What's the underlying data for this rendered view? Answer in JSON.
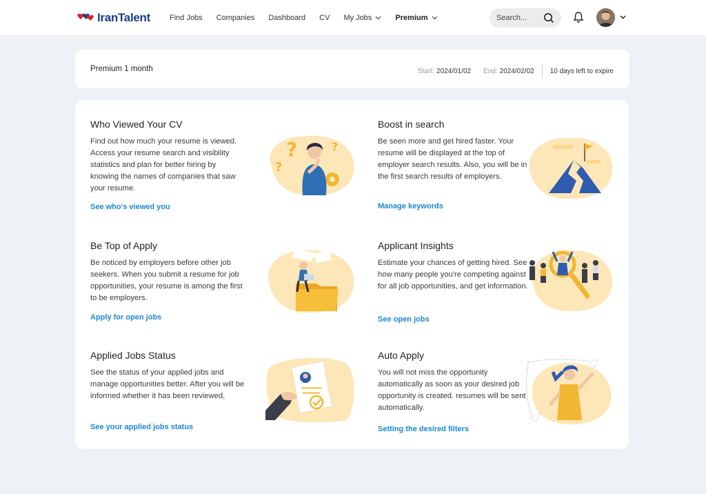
{
  "header": {
    "logo_text": "IranTalent",
    "nav": [
      {
        "label": "Find Jobs"
      },
      {
        "label": "Companies"
      },
      {
        "label": "Dashboard"
      },
      {
        "label": "CV"
      },
      {
        "label": "My Jobs"
      },
      {
        "label": "Premium"
      }
    ],
    "search_placeholder": "Search..."
  },
  "plan": {
    "title": "Premium 1 month",
    "start_label": "Start:",
    "start_value": "2024/01/02",
    "end_label": "End:",
    "end_value": "2024/02/02",
    "expire_text": "10 days left to expire"
  },
  "features": [
    {
      "title": "Who Viewed Your CV",
      "text": "Find out how much your resume is viewed. Access your resume search and visibility statistics and plan for better hiring by knowing the names of companies that saw your resume.",
      "link": "See who's viewed you"
    },
    {
      "title": "Boost in search",
      "text": "Be seen more and get hired faster. Your resume will be displayed at the top of employer search results. Also, you will be in the first search results of employers.",
      "link": "Manage keywords"
    },
    {
      "title": "Be Top of Apply",
      "text": "Be noticed by employers before other job seekers. When you submit a resume for job opportunities, your resume is among the first to be employers.",
      "link": "Apply for open jobs"
    },
    {
      "title": "Applicant Insights",
      "text": "Estimate your chances of getting hired. See how many people you're competing against for all job opportunities, and get information.",
      "link": "See open jobs"
    },
    {
      "title": "Applied Jobs Status",
      "text": "See the status of your applied jobs and manage opportunities better. After you will be informed whether it has been reviewed,",
      "link": "See your applied jobs status"
    },
    {
      "title": "Auto Apply",
      "text": "You will not miss the opportunity automatically as soon as your desired job opportunity is created. resumes will be sent automatically.",
      "link": "Setting the desired filters"
    }
  ],
  "colors": {
    "accent_link": "#1b87d6",
    "brand_blue": "#1a3e8c",
    "brand_red": "#e4202e",
    "illustration_blob": "#fde7b8",
    "page_bg": "#eef1f6"
  },
  "icons": [
    "search-icon",
    "bell-icon",
    "chevron-down-icon",
    "avatar"
  ]
}
